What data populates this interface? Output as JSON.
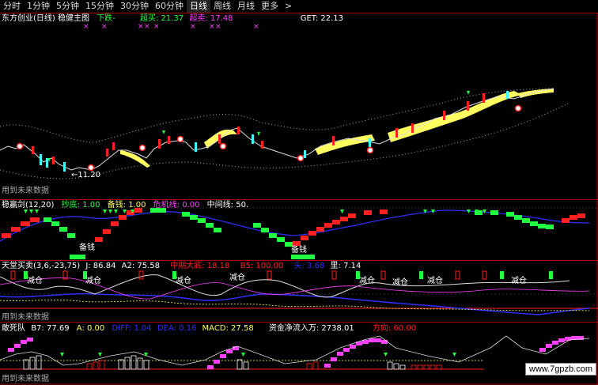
{
  "timeframe_tabs": [
    "分时",
    "1分钟",
    "5分钟",
    "15分钟",
    "30分钟",
    "60分钟",
    "日线",
    "周线",
    "月线",
    "更多"
  ],
  "active_tab": "日线",
  "more_arrow": ">",
  "main": {
    "stock": "东方创业(日线)",
    "indicator": "稳健主图",
    "trend": "下跌-",
    "overbuy": "超买: 21.37",
    "oversell": "超卖: 17.48",
    "get": "GET: 22.13",
    "low_marker": "←11.20",
    "future_data": "用到未来数据"
  },
  "panel1": {
    "name": "稳赢剑(12,20)",
    "sell_top": "抄底: 1.00",
    "ready": "备钱: 1.00",
    "danger": "危机线: 0.00",
    "mid": "中间线: 50.",
    "buy_label_1": "备钱",
    "buy_label_2": "备钱"
  },
  "panel2": {
    "name": "天堂买卖(3,6,-23,75)",
    "j": "J: 86.84",
    "a2": "A2: 75.58",
    "mid_big": "中期大底: 18.18",
    "b5": "B5: 100.00",
    "q": "头: 3.68",
    "li": "里: 7.14",
    "tags": [
      "减仓",
      "减仓",
      "减仓",
      "减仓",
      "减仓",
      "减仓",
      "减仓",
      "减仓"
    ],
    "future_data": "用到未来数据"
  },
  "panel3": {
    "name": "敢死队",
    "b7": "B7: 77.69",
    "a": "A: 0.00",
    "dif": "DIFF: 1.04",
    "dea": "DEA: 0.16",
    "macd": "MACD: 27.58",
    "fund": "资金净流入万: 2738.01",
    "direction": "方向: 60.00",
    "future_data": "用到未来数据"
  },
  "watermark": "www.7gpzb.com",
  "colors": {
    "up": "#ff2020",
    "down": "#20ff40",
    "yellow": "#ffff60",
    "blue": "#3030ff",
    "magenta": "#ff40ff",
    "cyan": "#40ffff"
  }
}
